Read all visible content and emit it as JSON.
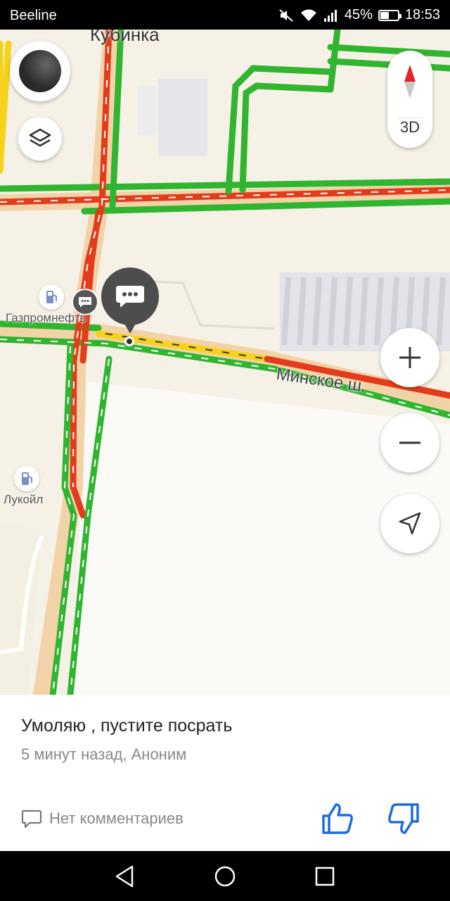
{
  "status_bar": {
    "carrier": "Beeline",
    "battery": "45%",
    "battery_level": 0.45,
    "time": "18:53"
  },
  "map": {
    "town_label": "Кубинка",
    "road_label": "Минское ш.",
    "poi_1_label": "Газпромнефть",
    "poi_2_label": "Лукойл",
    "btn_3d_label": "3D",
    "traffic_colors": {
      "free": "#2fb52f",
      "slow": "#f7d21a",
      "jam": "#e33c1c"
    }
  },
  "event_card": {
    "title": "Умоляю , пустите посрать",
    "meta": "5 минут назад, Аноним",
    "comments_label": "Нет комментариев",
    "accent_color": "#1e6be0"
  }
}
